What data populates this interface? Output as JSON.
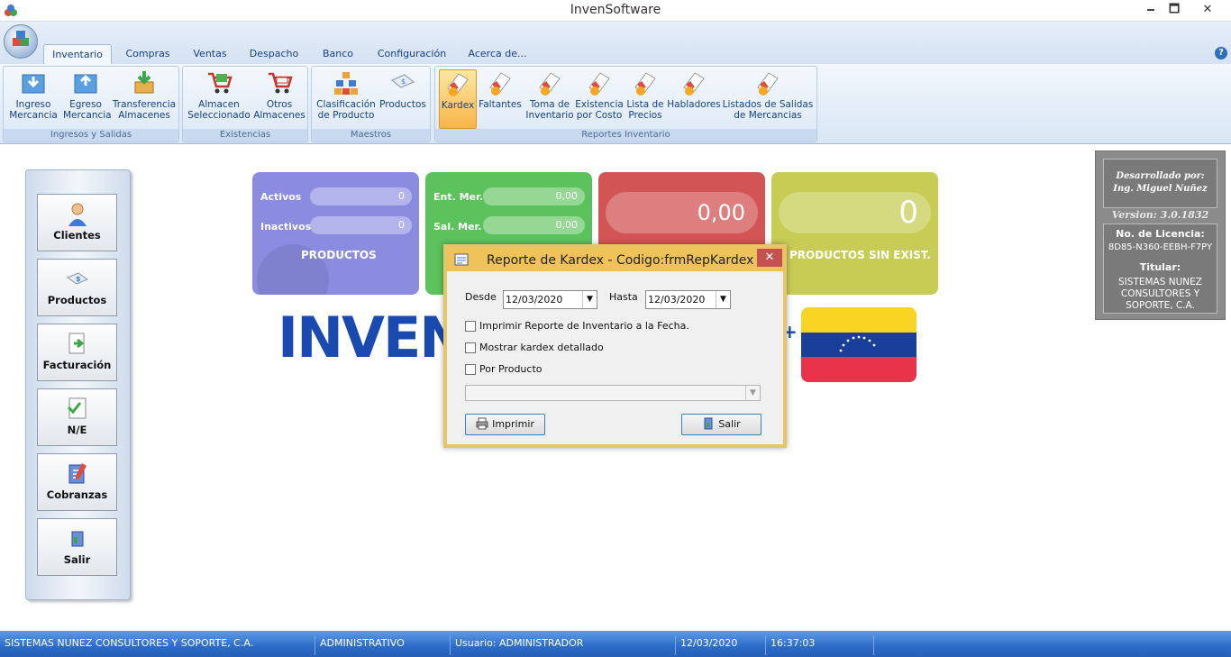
{
  "window": {
    "title": "InvenSoftware",
    "minimize": "🗕",
    "maximize": "🗖",
    "close": "✕"
  },
  "ribbon": {
    "tabs": [
      {
        "label": "Inventario"
      },
      {
        "label": "Compras"
      },
      {
        "label": "Ventas"
      },
      {
        "label": "Despacho"
      },
      {
        "label": "Banco"
      },
      {
        "label": "Configuración"
      },
      {
        "label": "Acerca de..."
      }
    ],
    "help": "?",
    "groups": [
      {
        "title": "Ingresos y Salidas",
        "buttons": [
          {
            "label": "Ingreso\nMercancia",
            "icon": "inbox-in-icon"
          },
          {
            "label": "Egreso\nMercancia",
            "icon": "inbox-out-icon"
          },
          {
            "label": "Transferencia\nAlmacenes",
            "icon": "transfer-icon"
          }
        ]
      },
      {
        "title": "Existencias",
        "buttons": [
          {
            "label": "Almacen\nSeleccionado",
            "icon": "cart-icon"
          },
          {
            "label": "Otros\nAlmacenes",
            "icon": "cart-icon"
          }
        ]
      },
      {
        "title": "Maestros",
        "buttons": [
          {
            "label": "Clasificación\nde Producto",
            "icon": "boxes-icon"
          },
          {
            "label": "Productos",
            "icon": "product-icon"
          }
        ]
      },
      {
        "title": "Reportes Inventario",
        "buttons": [
          {
            "label": "Kardex",
            "icon": "report-icon"
          },
          {
            "label": "Faltantes",
            "icon": "report-icon"
          },
          {
            "label": "Toma de\nInventario",
            "icon": "report-icon"
          },
          {
            "label": "Existencia\npor Costo",
            "icon": "report-icon"
          },
          {
            "label": "Lista de\nPrecios",
            "icon": "report-icon"
          },
          {
            "label": "Habladores",
            "icon": "report-icon"
          },
          {
            "label": "Listados de Salidas\nde Mercancias",
            "icon": "report-icon"
          }
        ]
      }
    ]
  },
  "sidebar": {
    "buttons": [
      {
        "label": "Clientes",
        "icon": "person-icon"
      },
      {
        "label": "Productos",
        "icon": "product-icon"
      },
      {
        "label": "Facturación",
        "icon": "invoice-icon"
      },
      {
        "label": "N/E",
        "icon": "check-document-icon"
      },
      {
        "label": "Cobranzas",
        "icon": "notepad-icon"
      },
      {
        "label": "Salir",
        "icon": "exit-door-icon"
      }
    ]
  },
  "cards": {
    "products": {
      "activos_label": "Activos",
      "activos_value": "0",
      "inactivos_label": "Inactivos",
      "inactivos_value": "0",
      "title": "PRODUCTOS",
      "color": "#8b8ce0"
    },
    "movements": {
      "ent_label": "Ent. Mer.",
      "ent_value": "0,00",
      "sal_label": "Sal. Mer.",
      "sal_value": "0,00",
      "color": "#5cc25c"
    },
    "amount": {
      "value": "0,00",
      "color": "#d35454"
    },
    "no_stock": {
      "value": "0",
      "title": "PRODUCTOS SIN EXIST.",
      "color": "#c7cc55"
    }
  },
  "logo": {
    "text": "INVEN",
    "plus": "+"
  },
  "info": {
    "developed_by": "Desarrollado por:",
    "developer": "Ing. Miguel Nuñez",
    "version": "Version: 3.0.1832",
    "license_label": "No. de Licencia:",
    "license": "8D85-N360-EEBH-F7PY",
    "holder_label": "Titular:",
    "holder": "SISTEMAS NUNEZ CONSULTORES Y SOPORTE, C.A."
  },
  "dialog": {
    "title": "Reporte de Kardex - Codigo:frmRepKardex",
    "close": "✕",
    "desde_label": "Desde",
    "desde_value": "12/03/2020",
    "hasta_label": "Hasta",
    "hasta_value": "12/03/2020",
    "opt_inventario": "Imprimir Reporte de Inventario a la Fecha.",
    "opt_detallado": "Mostrar kardex detallado",
    "opt_producto": "Por Producto",
    "producto_value": "",
    "print_label": "Imprimir",
    "exit_label": "Salir"
  },
  "status": {
    "company": "SISTEMAS NUNEZ CONSULTORES Y SOPORTE, C.A.",
    "role": "ADMINISTRATIVO",
    "user": "Usuario: ADMINISTRADOR",
    "date": "12/03/2020",
    "time": "16:37:03"
  }
}
